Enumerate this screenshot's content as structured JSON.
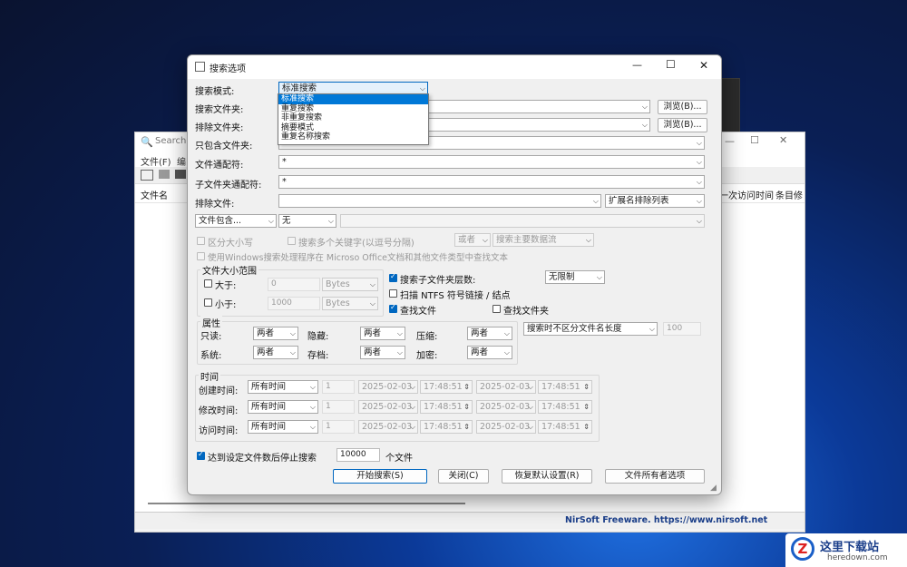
{
  "bg_window": {
    "title": "SearchM",
    "menu": [
      "文件(F)",
      "编"
    ],
    "col_filename": "文件名",
    "col_last_access": "一次访问时间",
    "col_entries": "条目修",
    "status": "NirSoft Freeware. https://www.nirsoft.net"
  },
  "dialog": {
    "title": "搜索选项",
    "controls": {
      "minimize": "—",
      "maximize": "☐",
      "close": "✕"
    },
    "search_mode_label": "搜索模式:",
    "search_mode_value": "标准搜索",
    "search_mode_options": [
      "标准搜索",
      "重复搜索",
      "非重复搜索",
      "摘要模式",
      "重复名称搜索"
    ],
    "search_folder_label": "搜索文件夹:",
    "exclude_folder_label": "排除文件夹:",
    "browse_label": "浏览(B)...",
    "include_only_label": "只包含文件夹:",
    "file_wildcard_label": "文件通配符:",
    "file_wildcard_value": "*",
    "subfolder_wildcard_label": "子文件夹通配符:",
    "subfolder_wildcard_value": "*",
    "exclude_files_label": "排除文件:",
    "ext_exclude_value": "扩展名排除列表",
    "file_contains_value": "文件包含...",
    "none_value": "无",
    "case_sensitive_label": "区分大小写",
    "multi_keyword_label": "搜索多个关键字(以逗号分隔)",
    "or_value": "或者",
    "main_stream_value": "搜索主要数据流",
    "windows_search_label": "使用Windows搜索处理程序在 Microso Office文档和其他文件类型中查找文本",
    "size_group_label": "文件大小范围",
    "greater_label": "大于:",
    "greater_value": "0",
    "less_label": "小于:",
    "less_value": "1000",
    "bytes_value": "Bytes",
    "subfolder_depth_label": "搜索子文件夹层数:",
    "subfolder_depth_value": "无限制",
    "ntfs_label": "扫描 NTFS 符号链接 / 结点",
    "find_files_label": "查找文件",
    "find_folders_label": "查找文件夹",
    "attr_group_label": "属性",
    "readonly_label": "只读:",
    "hidden_label": "隐藏:",
    "compressed_label": "压缩:",
    "system_label": "系统:",
    "archive_label": "存档:",
    "encrypted_label": "加密:",
    "both_value": "两者",
    "name_length_value": "搜索时不区分文件名长度",
    "name_length_number": "100",
    "time_group_label": "时间",
    "created_label": "创建时间:",
    "modified_label": "修改时间:",
    "accessed_label": "访问时间:",
    "all_time_value": "所有时间",
    "one_value": "1",
    "date_value": "2025-02-03",
    "time_value": "17:48:51",
    "stop_after_label": "达到设定文件数后停止搜索",
    "stop_after_value": "10000",
    "files_unit_label": "个文件",
    "start_button": "开始搜索(S)",
    "close_button": "关闭(C)",
    "reset_button": "恢复默认设置(R)",
    "owner_button": "文件所有者选项"
  },
  "watermark": {
    "title": "这里下载站",
    "url": "heredown.com"
  },
  "colors": {
    "accent": "#0067c0",
    "selection": "#0078d7"
  }
}
